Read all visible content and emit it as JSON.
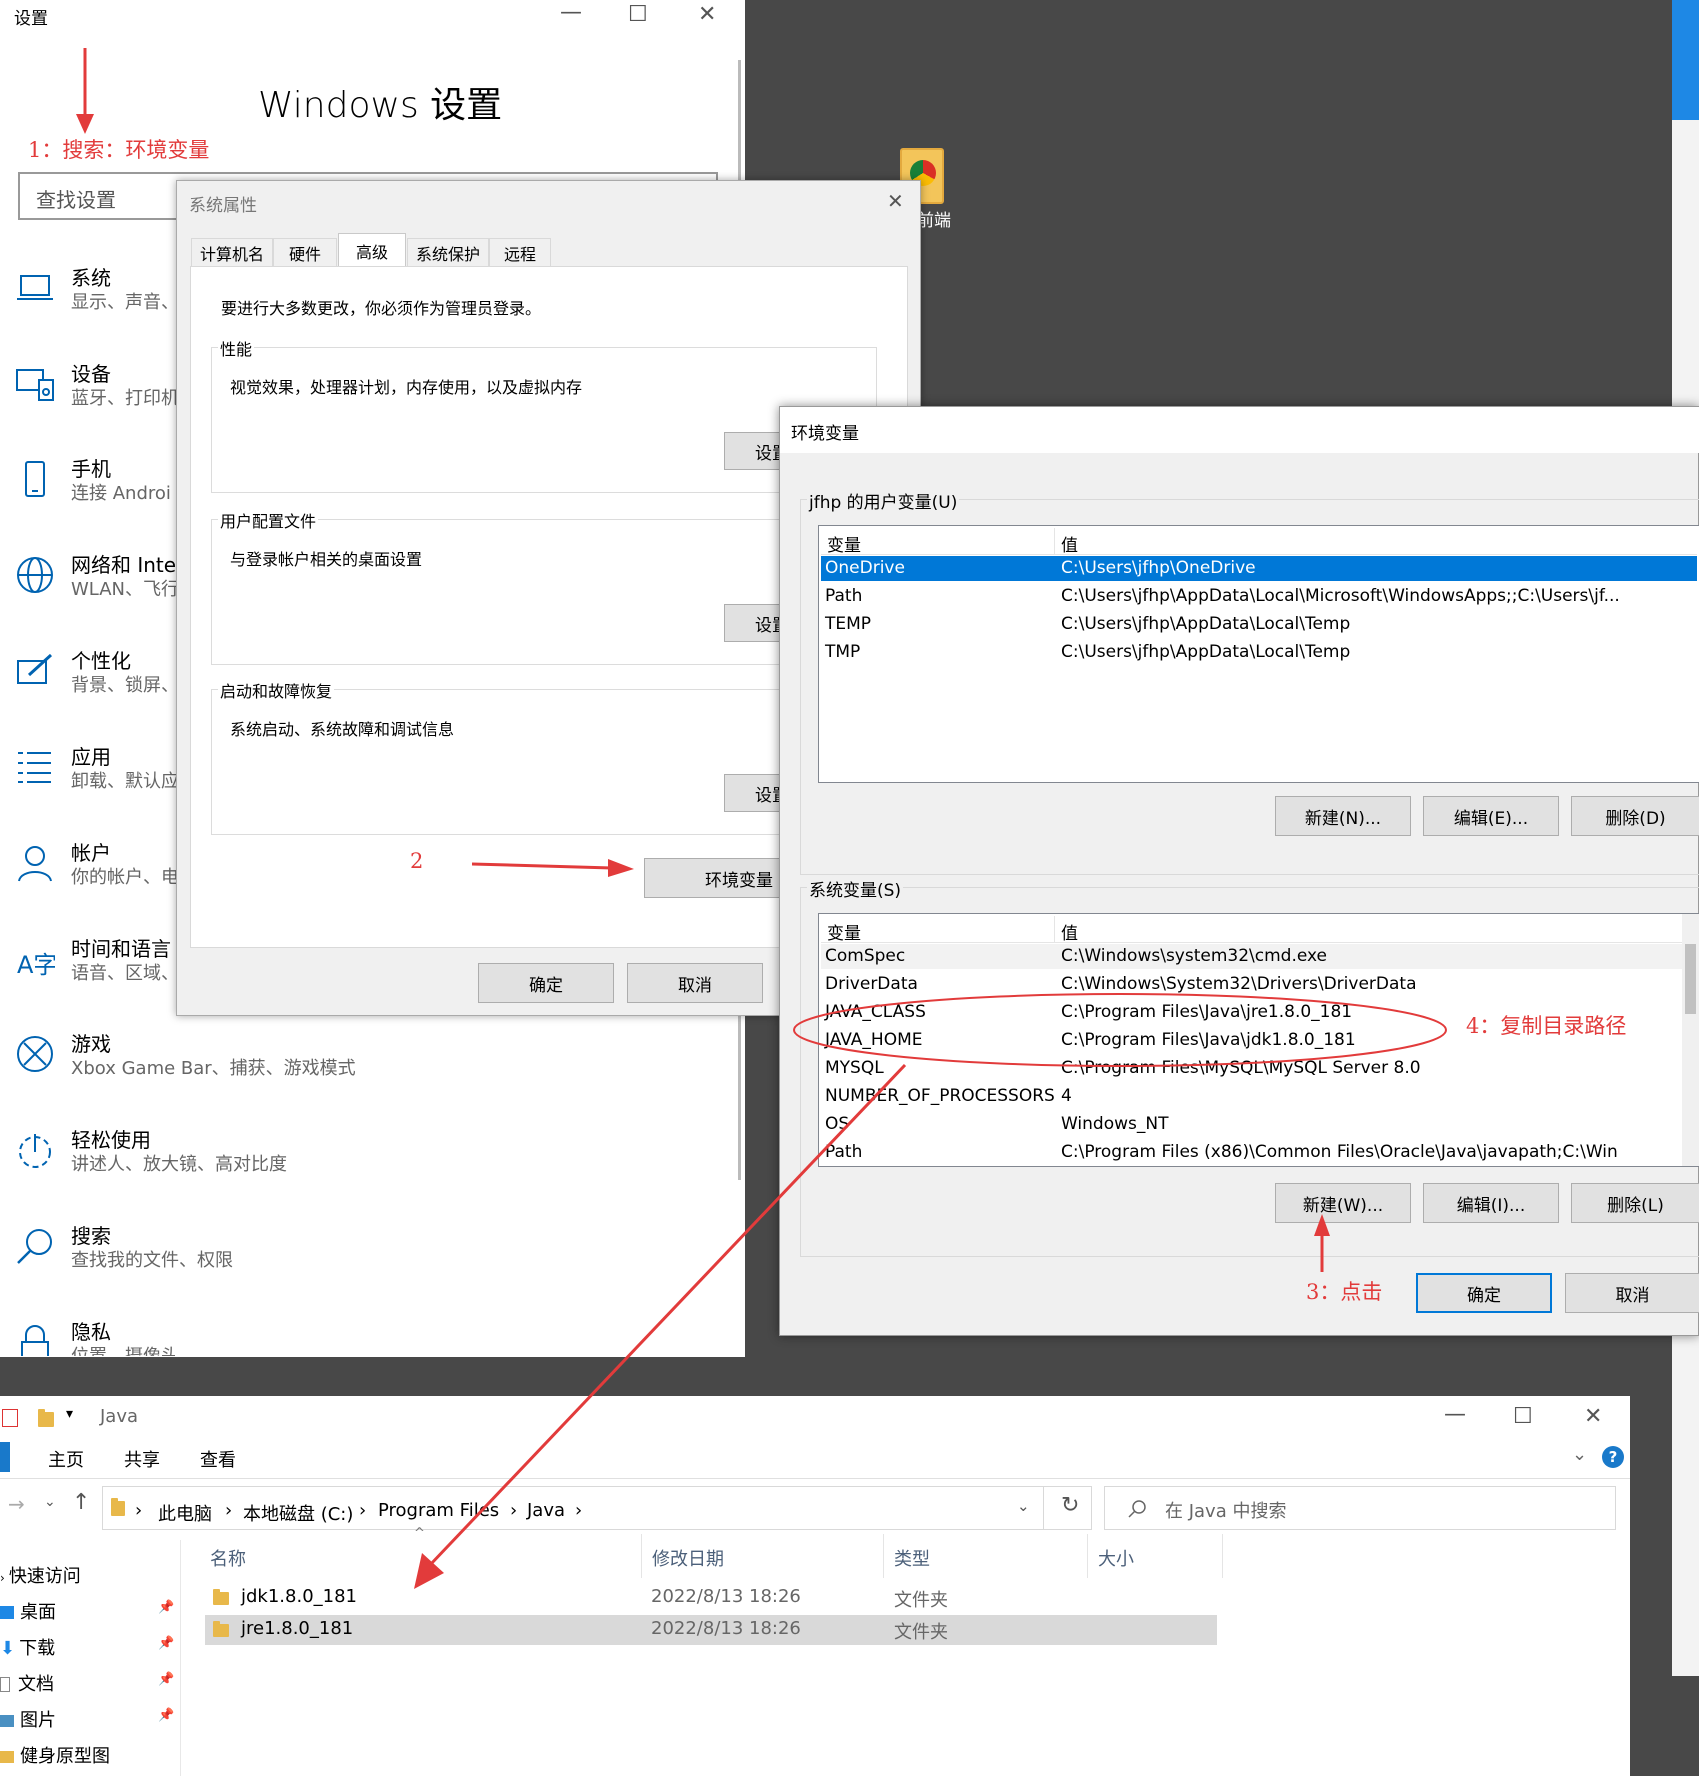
{
  "settings": {
    "window_title": "设置",
    "heading": "Windows 设置",
    "search_placeholder": "查找设置",
    "categories": [
      {
        "title": "系统",
        "subtitle": "显示、声音、"
      },
      {
        "title": "设备",
        "subtitle": "蓝牙、打印机"
      },
      {
        "title": "手机",
        "subtitle": "连接 Androi"
      },
      {
        "title": "网络和 Inte",
        "subtitle": "WLAN、飞行"
      },
      {
        "title": "个性化",
        "subtitle": "背景、锁屏、"
      },
      {
        "title": "应用",
        "subtitle": "卸载、默认应"
      },
      {
        "title": "帐户",
        "subtitle": "你的帐户、电"
      },
      {
        "title": "时间和语言",
        "subtitle": "语音、区域、"
      },
      {
        "title": "游戏",
        "subtitle": "Xbox Game Bar、捕获、游戏模式"
      },
      {
        "title": "轻松使用",
        "subtitle": "讲述人、放大镜、高对比度"
      },
      {
        "title": "搜索",
        "subtitle": "查找我的文件、权限"
      },
      {
        "title": "隐私",
        "subtitle": "位置、摄像头、麦克风"
      }
    ]
  },
  "annotations": {
    "step1": "1：搜索：环境变量",
    "step2": "2",
    "step3": "3：点击",
    "step4": "4：复制目录路径"
  },
  "desktop": {
    "icon_label": "端前端"
  },
  "sysprops": {
    "title": "系统属性",
    "tabs": [
      "计算机名",
      "硬件",
      "高级",
      "系统保护",
      "远程"
    ],
    "admin_note": "要进行大多数更改，你必须作为管理员登录。",
    "perf_label": "性能",
    "perf_desc": "视觉效果，处理器计划，内存使用，以及虚拟内存",
    "profile_label": "用户配置文件",
    "profile_desc": "与登录帐户相关的桌面设置",
    "startup_label": "启动和故障恢复",
    "startup_desc": "系统启动、系统故障和调试信息",
    "settings_btn": "设置",
    "env_btn": "环境变量",
    "ok": "确定",
    "cancel": "取消"
  },
  "envvars": {
    "title": "环境变量",
    "user_label": "jfhp 的用户变量(U)",
    "col_var": "变量",
    "col_val": "值",
    "user_rows": [
      {
        "name": "OneDrive",
        "value": "C:\\Users\\jfhp\\OneDrive"
      },
      {
        "name": "Path",
        "value": "C:\\Users\\jfhp\\AppData\\Local\\Microsoft\\WindowsApps;;C:\\Users\\jf..."
      },
      {
        "name": "TEMP",
        "value": "C:\\Users\\jfhp\\AppData\\Local\\Temp"
      },
      {
        "name": "TMP",
        "value": "C:\\Users\\jfhp\\AppData\\Local\\Temp"
      }
    ],
    "user_new": "新建(N)...",
    "user_edit": "编辑(E)...",
    "user_delete": "删除(D)",
    "sys_label": "系统变量(S)",
    "sys_rows": [
      {
        "name": "ComSpec",
        "value": "C:\\Windows\\system32\\cmd.exe"
      },
      {
        "name": "DriverData",
        "value": "C:\\Windows\\System32\\Drivers\\DriverData"
      },
      {
        "name": "JAVA_CLASS",
        "value": "C:\\Program Files\\Java\\jre1.8.0_181"
      },
      {
        "name": "JAVA_HOME",
        "value": "C:\\Program Files\\Java\\jdk1.8.0_181"
      },
      {
        "name": "MYSQL",
        "value": "C:\\Program Files\\MySQL\\MySQL Server 8.0"
      },
      {
        "name": "NUMBER_OF_PROCESSORS",
        "value": "4"
      },
      {
        "name": "OS",
        "value": "Windows_NT"
      },
      {
        "name": "Path",
        "value": "C:\\Program Files (x86)\\Common Files\\Oracle\\Java\\javapath;C:\\Win"
      }
    ],
    "sys_new": "新建(W)...",
    "sys_edit": "编辑(I)...",
    "sys_delete": "删除(L)",
    "ok": "确定",
    "cancel": "取消"
  },
  "explorer": {
    "title": "Java",
    "ribbon_tabs": [
      "主页",
      "共享",
      "查看"
    ],
    "crumbs": [
      "此电脑",
      "本地磁盘 (C:)",
      "Program Files",
      "Java"
    ],
    "search_placeholder": "在 Java 中搜索",
    "cols": {
      "name": "名称",
      "date": "修改日期",
      "type": "类型",
      "size": "大小"
    },
    "quick_access": "快速访问",
    "nav": [
      "桌面",
      "下载",
      "文档",
      "图片",
      "健身原型图"
    ],
    "files": [
      {
        "name": "jdk1.8.0_181",
        "date": "2022/8/13 18:26",
        "type": "文件夹"
      },
      {
        "name": "jre1.8.0_181",
        "date": "2022/8/13 18:26",
        "type": "文件夹"
      }
    ]
  }
}
